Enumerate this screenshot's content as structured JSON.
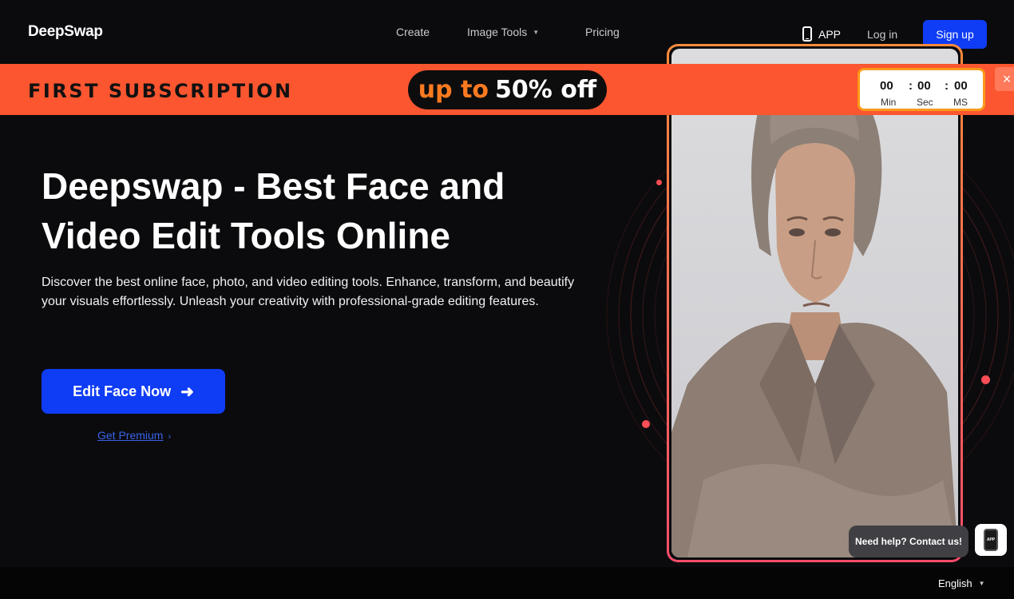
{
  "header": {
    "logo": "DeepSwap",
    "nav": [
      {
        "label": "Create"
      },
      {
        "label": "Image Tools"
      },
      {
        "label": "Pricing"
      }
    ],
    "app_label": "APP",
    "login_label": "Log in",
    "signup_label": "Sign up"
  },
  "banner": {
    "title": "FIRST SUBSCRIPTION",
    "offer_prefix": "up to",
    "offer_value": "50% off",
    "countdown": {
      "min": "00",
      "sec": "00",
      "ms": "00",
      "min_label": "Min",
      "sec_label": "Sec",
      "ms_label": "MS",
      "separator": ":"
    },
    "close_icon": "×"
  },
  "hero": {
    "title_line1": "Deepswap - Best Face and",
    "title_line2": "Video Edit Tools Online",
    "description": "Discover the best online face, photo, and video editing tools. Enhance, transform, and beautify your visuals effortlessly. Unleash your creativity with professional-grade editing features.",
    "cta_label": "Edit Face Now",
    "cta_arrow": "➜",
    "premium_label": "Get Premium",
    "premium_chevron": "›"
  },
  "help": {
    "label": "Need help? Contact us!",
    "app_widget_text": "APP"
  },
  "footer": {
    "language": "English"
  },
  "colors": {
    "accent_blue": "#0f3cf5",
    "banner_orange": "#fb5630",
    "background": "#0b0b0e"
  }
}
